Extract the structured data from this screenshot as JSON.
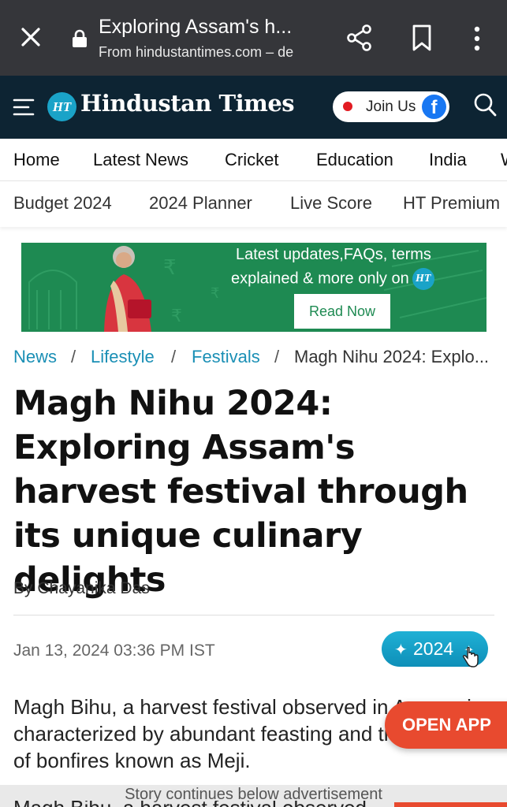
{
  "browser": {
    "title": "Exploring Assam's h...",
    "subtitle": "From hindustantimes.com – de",
    "icons": [
      "close-icon",
      "lock-icon",
      "share-icon",
      "bookmark-icon",
      "more-vert-icon"
    ]
  },
  "header": {
    "logo_badge": "HT",
    "logo_text": "Hindustan Times",
    "join_label": "Join Us",
    "join_fb": "f"
  },
  "nav_primary": [
    "Home",
    "Latest News",
    "Cricket",
    "Education",
    "India",
    "W"
  ],
  "nav_secondary": [
    "Budget 2024",
    "2024 Planner",
    "Live Score",
    "HT Premium"
  ],
  "banner": {
    "line1": "Latest updates,FAQs, terms",
    "line2": "explained & more only on",
    "badge": "HT",
    "cta": "Read Now",
    "color": "#1e8a52"
  },
  "breadcrumb": [
    "News",
    "Lifestyle",
    "Festivals",
    "Magh Nihu 2024: Explo..."
  ],
  "article": {
    "headline": "Magh Nihu 2024: Exploring Assam's harvest festival through its unique culinary delights",
    "byline": "By Chayanika Das",
    "date": "Jan 13, 2024 03:36 PM IST",
    "badge_year": "2024",
    "paragraph": "Magh Bihu, a harvest festival observed in Assam, is characterized by abundant feasting and the lighting of bonfires known as Meji.",
    "ghost_paragraph": "Magh Bihu, a harvest festival observed"
  },
  "open_app": "OPEN APP",
  "ad_notice": "Story continues below advertisement",
  "colors": {
    "brand_dark": "#0d2433",
    "link": "#1a8fb5",
    "accent": "#e84a2f",
    "badge": "#1aa3c8"
  }
}
